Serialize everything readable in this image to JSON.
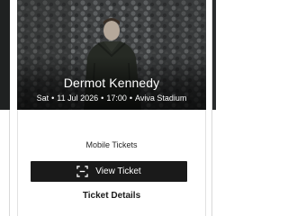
{
  "event": {
    "artist": "Dermot Kennedy",
    "day": "Sat",
    "date": "11 Jul 2026",
    "time": "17:00",
    "venue": "Aviva Stadium",
    "separator": "•"
  },
  "ticket": {
    "delivery_label": "Mobile Tickets",
    "view_button_label": "View Ticket",
    "view_button_icon": "qr-scan-icon",
    "details_link_label": "Ticket Details"
  },
  "colors": {
    "button_bg": "#1a1a1a",
    "hero_overlay_text": "#ffffff",
    "page_bg": "#ffffff"
  }
}
